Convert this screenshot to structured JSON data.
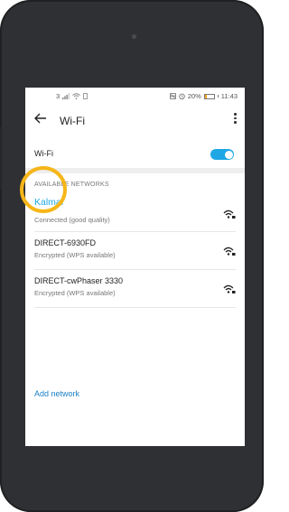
{
  "statusbar": {
    "left_text": "3",
    "battery_pct": "20%",
    "time": "11:43"
  },
  "appbar": {
    "title": "Wi-Fi"
  },
  "wifi_toggle": {
    "label": "Wi-Fi",
    "enabled": true
  },
  "section": {
    "label": "AVAILABLE NETWORKS"
  },
  "networks": [
    {
      "name": "Kalmar",
      "status": "Connected (good quality)",
      "active": true
    },
    {
      "name": "DIRECT-6930FD",
      "status": "Encrypted (WPS available)",
      "active": false
    },
    {
      "name": "DIRECT-cwPhaser 3330",
      "status": "Encrypted (WPS available)",
      "active": false
    }
  ],
  "add_network": {
    "label": "Add network"
  },
  "colors": {
    "accent": "#1ea7e4",
    "link": "#1a7fc4",
    "highlight_ring": "#f6b619",
    "battery": "#f5a623"
  }
}
